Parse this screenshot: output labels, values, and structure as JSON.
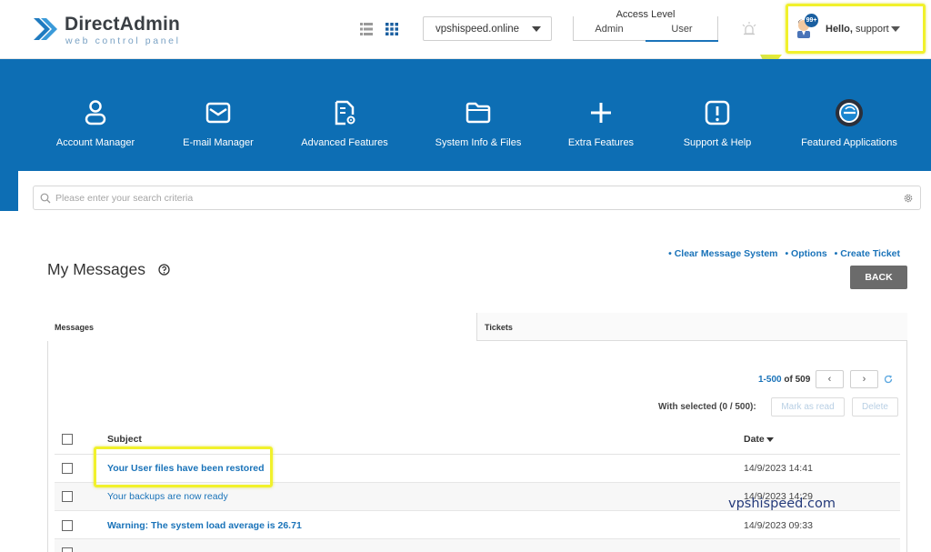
{
  "header": {
    "logo_title": "DirectAdmin",
    "logo_subtitle": "web control panel",
    "domain_select": "vpshispeed.online",
    "access_level": {
      "title": "Access Level",
      "admin": "Admin",
      "user": "User",
      "active": "User"
    },
    "user": {
      "greeting": "Hello,",
      "name": "support",
      "badge": "99+"
    }
  },
  "nav": [
    {
      "label": "Account Manager",
      "icon": "user-icon"
    },
    {
      "label": "E-mail Manager",
      "icon": "envelope-icon"
    },
    {
      "label": "Advanced Features",
      "icon": "file-gear-icon"
    },
    {
      "label": "System Info & Files",
      "icon": "folder-icon"
    },
    {
      "label": "Extra Features",
      "icon": "plus-icon"
    },
    {
      "label": "Support & Help",
      "icon": "exclamation-icon"
    },
    {
      "label": "Featured Applications",
      "icon": "app-icon"
    }
  ],
  "search": {
    "placeholder": "Please enter your search criteria"
  },
  "page": {
    "title": "My Messages",
    "links": [
      "• Clear Message System",
      "• Options",
      "• Create Ticket"
    ],
    "back_label": "BACK"
  },
  "tabs": {
    "messages": "Messages",
    "tickets": "Tickets",
    "active": "Messages"
  },
  "pagination": {
    "range": "1-500",
    "of": "of",
    "total": "509",
    "prev": "‹",
    "next": "›"
  },
  "bulk": {
    "with_selected": "With selected (0 / 500):",
    "mark_read": "Mark as read",
    "delete": "Delete"
  },
  "table": {
    "headers": {
      "subject": "Subject",
      "date": "Date"
    },
    "rows": [
      {
        "subject": "Your User files have been restored",
        "date": "14/9/2023 14:41",
        "unread": true
      },
      {
        "subject": "Your backups are now ready",
        "date": "14/9/2023 14:29",
        "unread": false
      },
      {
        "subject": "Warning: The system load average is 26.71",
        "date": "14/9/2023 09:33",
        "unread": true
      }
    ]
  },
  "watermark": "vpshispeed.com",
  "colors": {
    "brand_blue": "#0d6eb4",
    "link_blue": "#1a73b9",
    "highlight": "#f1f12b"
  }
}
